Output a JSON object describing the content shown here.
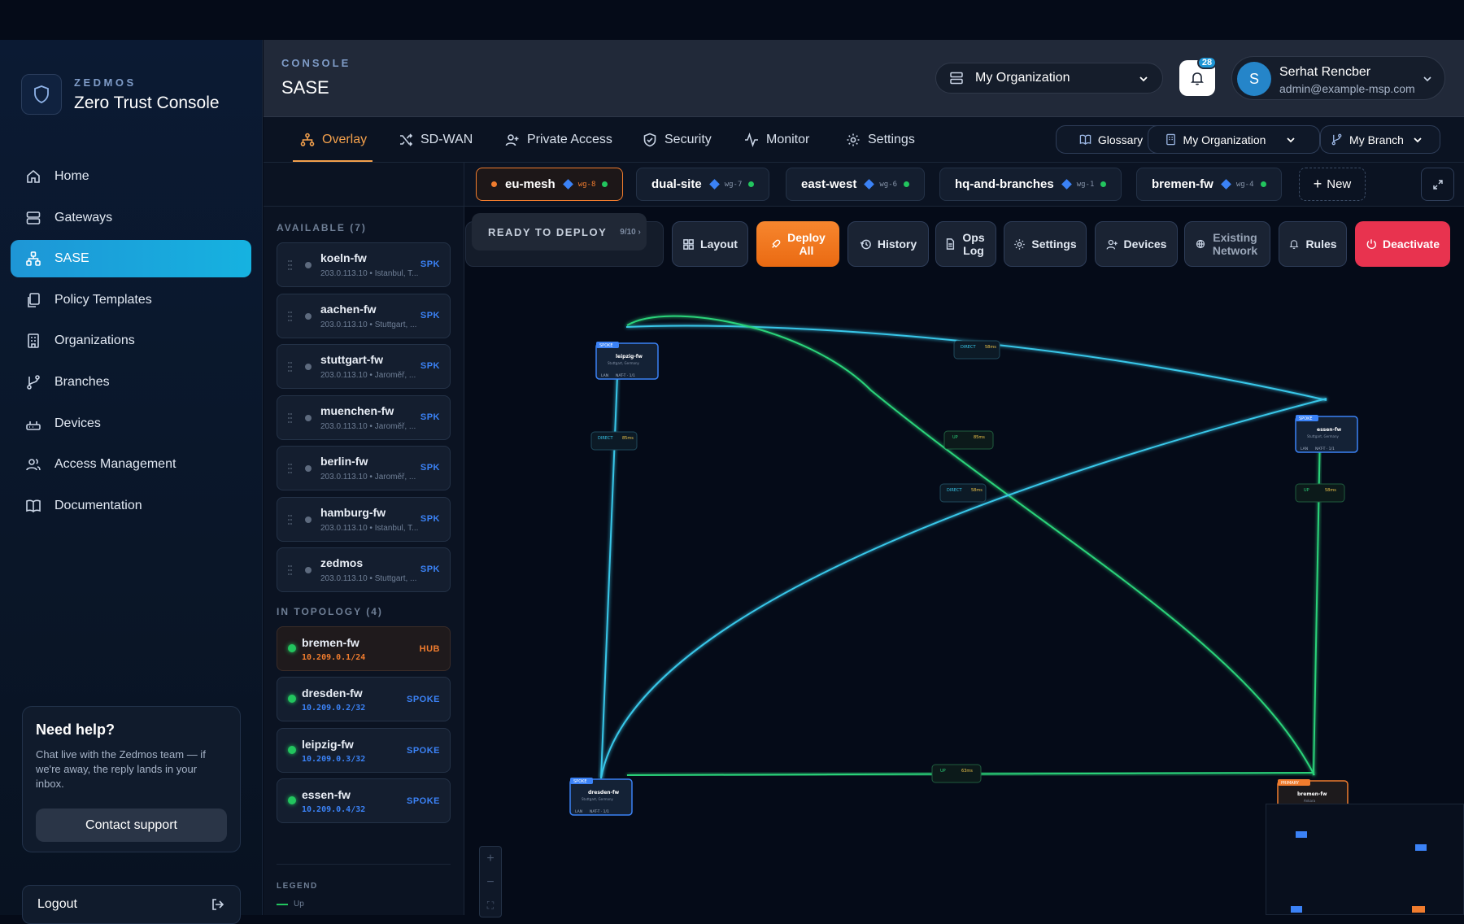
{
  "brand": {
    "kicker": "ZEDMOS",
    "title": "Zero Trust Console"
  },
  "nav": [
    {
      "label": "Home",
      "icon": "home-icon"
    },
    {
      "label": "Gateways",
      "icon": "server-icon"
    },
    {
      "label": "SASE",
      "icon": "network-icon",
      "active": true
    },
    {
      "label": "Policy Templates",
      "icon": "copy-icon"
    },
    {
      "label": "Organizations",
      "icon": "building-icon"
    },
    {
      "label": "Branches",
      "icon": "git-branch-icon"
    },
    {
      "label": "Devices",
      "icon": "router-icon"
    },
    {
      "label": "Access Management",
      "icon": "users-icon"
    },
    {
      "label": "Documentation",
      "icon": "book-icon"
    }
  ],
  "help": {
    "title": "Need help?",
    "text": "Chat live with the Zedmos team — if we're away, the reply lands in your inbox.",
    "button": "Contact support"
  },
  "logout": "Logout",
  "header": {
    "kicker": "CONSOLE",
    "title": "SASE",
    "org": "My Organization",
    "notifications": "28",
    "user_name": "Serhat Rencber",
    "user_email": "admin@example-msp.com",
    "user_initial": "S"
  },
  "tabs": [
    "Overlay",
    "SD-WAN",
    "Private Access",
    "Security",
    "Monitor",
    "Settings"
  ],
  "pills": {
    "glossary": "Glossary",
    "org": "My Organization",
    "branch": "My Branch"
  },
  "overlays": [
    {
      "name": "eu-mesh",
      "wg": "wg-8",
      "active": true
    },
    {
      "name": "dual-site",
      "wg": "wg-7"
    },
    {
      "name": "east-west",
      "wg": "wg-6"
    },
    {
      "name": "hq-and-branches",
      "wg": "wg-1"
    },
    {
      "name": "bremen-fw",
      "wg": "wg-4"
    }
  ],
  "new_label": "New",
  "ready": {
    "label": "READY TO DEPLOY",
    "count": "9/10 ›"
  },
  "toolbar": {
    "layout": "Layout",
    "deploy": "Deploy All",
    "history": "History",
    "opslog": "Ops Log",
    "settings": "Settings",
    "devices": "Devices",
    "existing": "Existing Network",
    "rules": "Rules",
    "deactivate": "Deactivate"
  },
  "available_header": "AVAILABLE (7)",
  "available": [
    {
      "name": "koeln-fw",
      "sub": "203.0.113.10 • Istanbul, T...",
      "tag": "SPK"
    },
    {
      "name": "aachen-fw",
      "sub": "203.0.113.10 • Stuttgart, ...",
      "tag": "SPK"
    },
    {
      "name": "stuttgart-fw",
      "sub": "203.0.113.10 • Jaroměř, ...",
      "tag": "SPK"
    },
    {
      "name": "muenchen-fw",
      "sub": "203.0.113.10 • Jaroměř, ...",
      "tag": "SPK"
    },
    {
      "name": "berlin-fw",
      "sub": "203.0.113.10 • Jaroměř, ...",
      "tag": "SPK"
    },
    {
      "name": "hamburg-fw",
      "sub": "203.0.113.10 • Istanbul, T...",
      "tag": "SPK"
    },
    {
      "name": "zedmos",
      "sub": "203.0.113.10 • Stuttgart, ...",
      "tag": "SPK"
    }
  ],
  "topology_header": "IN TOPOLOGY (4)",
  "topology": [
    {
      "name": "bremen-fw",
      "ip": "10.209.0.1/24",
      "tag": "HUB"
    },
    {
      "name": "dresden-fw",
      "ip": "10.209.0.2/32",
      "tag": "SPOKE"
    },
    {
      "name": "leipzig-fw",
      "ip": "10.209.0.3/32",
      "tag": "SPOKE"
    },
    {
      "name": "essen-fw",
      "ip": "10.209.0.4/32",
      "tag": "SPOKE"
    }
  ],
  "legend": {
    "header": "LEGEND",
    "up": "Up"
  },
  "graph": {
    "nodes": [
      {
        "name": "leipzig-fw",
        "role": "SPOKE",
        "loc": "Stuttgart, Germany"
      },
      {
        "name": "essen-fw",
        "role": "SPOKE",
        "loc": "Stuttgart, Germany"
      },
      {
        "name": "dresden-fw",
        "role": "SPOKE",
        "loc": "Stuttgart, Germany"
      },
      {
        "name": "bremen-fw",
        "role": "PRIMARY",
        "loc": "Ankara"
      }
    ],
    "links": [
      {
        "label": "DIRECT",
        "latency": "58ms"
      },
      {
        "label": "DIRECT",
        "latency": "85ms"
      },
      {
        "label": "UP",
        "latency": "85ms"
      },
      {
        "label": "DIRECT",
        "latency": "58ms"
      },
      {
        "label": "UP",
        "latency": "58ms"
      },
      {
        "label": "UP",
        "latency": "63ms"
      }
    ],
    "lan": "LAN",
    "nat": "NAT-T · 1/1"
  },
  "colors": {
    "accent": "#1e96d6",
    "orange": "#f07c2e",
    "green": "#22c55e",
    "cyan": "#38c6e8",
    "red": "#e8334f"
  }
}
